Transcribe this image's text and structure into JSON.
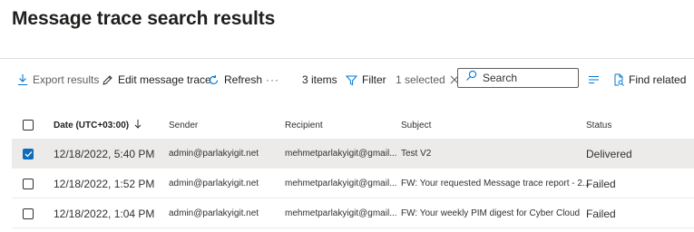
{
  "page": {
    "title": "Message trace search results"
  },
  "toolbar": {
    "export_label": "Export results",
    "edit_label": "Edit message trace",
    "refresh_label": "Refresh",
    "more_label": "···",
    "item_count": "3 items",
    "filter_label": "Filter",
    "selected_label": "1 selected",
    "search_placeholder": "Search",
    "find_related_label": "Find related"
  },
  "table": {
    "columns": {
      "date": "Date (UTC+03:00)",
      "sender": "Sender",
      "recipient": "Recipient",
      "subject": "Subject",
      "status": "Status"
    },
    "rows": [
      {
        "checked": true,
        "date": "12/18/2022, 5:40 PM",
        "sender": "admin@parlakyigit.net",
        "recipient": "mehmetparlakyigit@gmail...",
        "subject": "Test V2",
        "status": "Delivered"
      },
      {
        "checked": false,
        "date": "12/18/2022, 1:52 PM",
        "sender": "admin@parlakyigit.net",
        "recipient": "mehmetparlakyigit@gmail...",
        "subject": "FW: Your requested Message trace report - 2...",
        "status": "Failed"
      },
      {
        "checked": false,
        "date": "12/18/2022, 1:04 PM",
        "sender": "admin@parlakyigit.net",
        "recipient": "mehmetparlakyigit@gmail...",
        "subject": "FW: Your weekly PIM digest for Cyber Cloud",
        "status": "Failed"
      }
    ]
  },
  "colors": {
    "accent": "#0f6cbd",
    "selected_row": "#edebe9",
    "icon_blue": "#0078d4"
  }
}
